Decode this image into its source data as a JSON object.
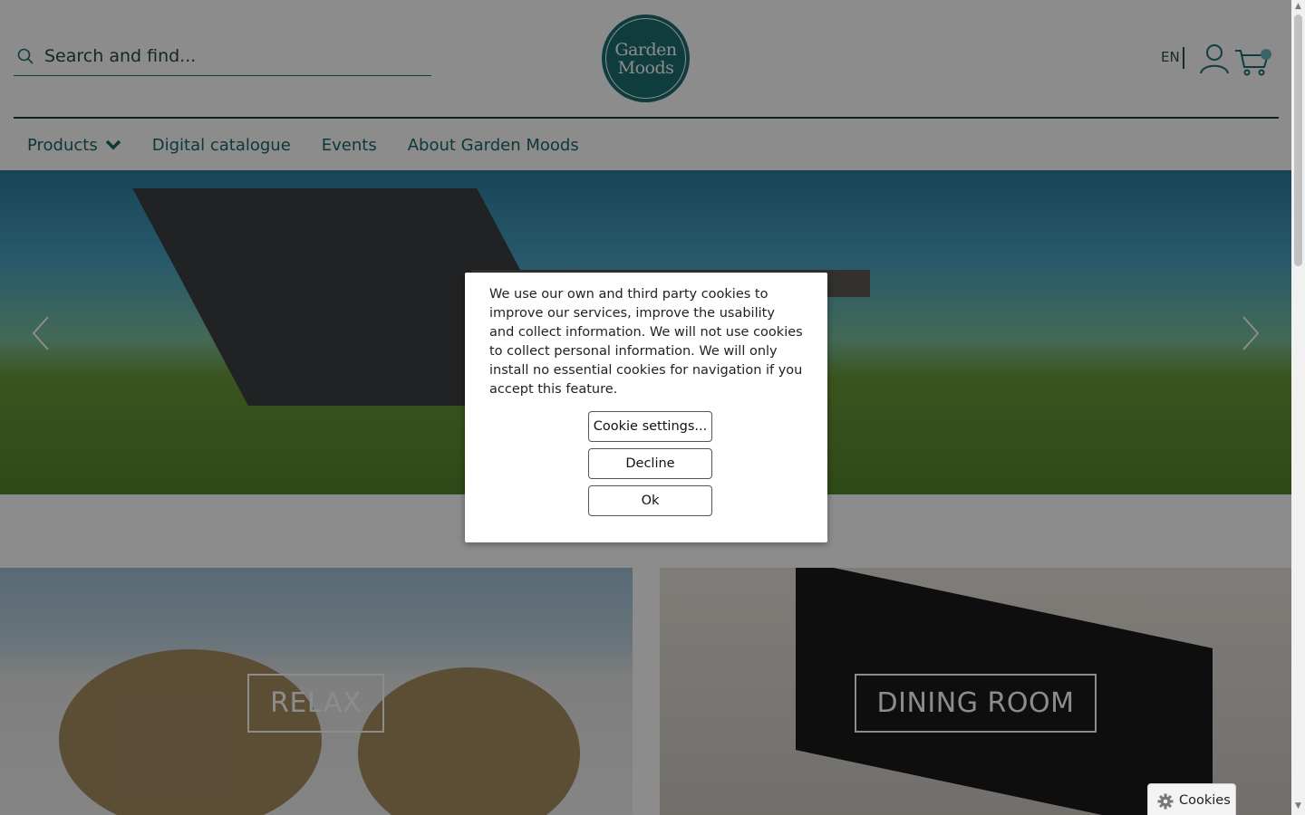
{
  "header": {
    "search": {
      "placeholder": "Search and find..."
    },
    "logo": {
      "line1": "Garden",
      "line2": "Moods"
    },
    "language": "EN"
  },
  "nav": {
    "items": [
      {
        "label": "Products",
        "has_dropdown": true
      },
      {
        "label": "Digital catalogue"
      },
      {
        "label": "Events"
      },
      {
        "label": "About Garden Moods"
      }
    ]
  },
  "tiles": [
    {
      "label": "RELAX"
    },
    {
      "label": "DINING ROOM"
    }
  ],
  "cookie_modal": {
    "text": "We use our own and third party cookies to improve our services, improve the usability and collect information. We will not use cookies to collect personal information. We will only install no essential cookies for navigation if you accept this feature.",
    "buttons": {
      "settings": "Cookie settings...",
      "decline": "Decline",
      "ok": "Ok"
    }
  },
  "cookies_tab": {
    "label": "Cookies"
  },
  "colors": {
    "brand": "#1c6f72",
    "nav_text": "#1b6669",
    "cart_badge": "#6cb6bd"
  }
}
